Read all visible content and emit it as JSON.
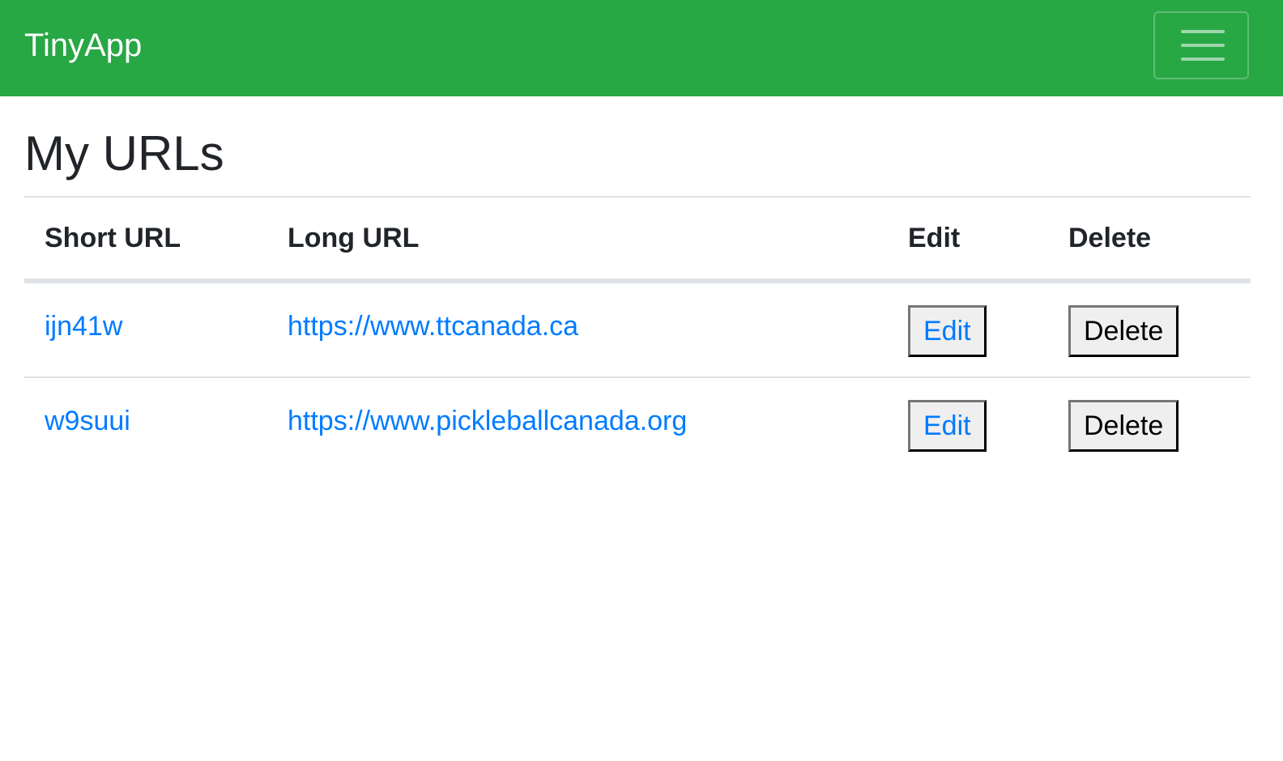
{
  "navbar": {
    "brand": "TinyApp",
    "toggle_icon": "hamburger-menu-icon",
    "bg_color": "#28a745"
  },
  "page": {
    "title": "My URLs"
  },
  "table": {
    "headers": [
      "Short URL",
      "Long URL",
      "Edit",
      "Delete"
    ],
    "rows": [
      {
        "short_url": "ijn41w",
        "long_url": "https://www.ttcanada.ca",
        "edit_label": "Edit",
        "delete_label": "Delete"
      },
      {
        "short_url": "w9suui",
        "long_url": "https://www.pickleballcanada.org",
        "edit_label": "Edit",
        "delete_label": "Delete"
      }
    ]
  },
  "colors": {
    "link": "#007bff",
    "text": "#212529"
  }
}
